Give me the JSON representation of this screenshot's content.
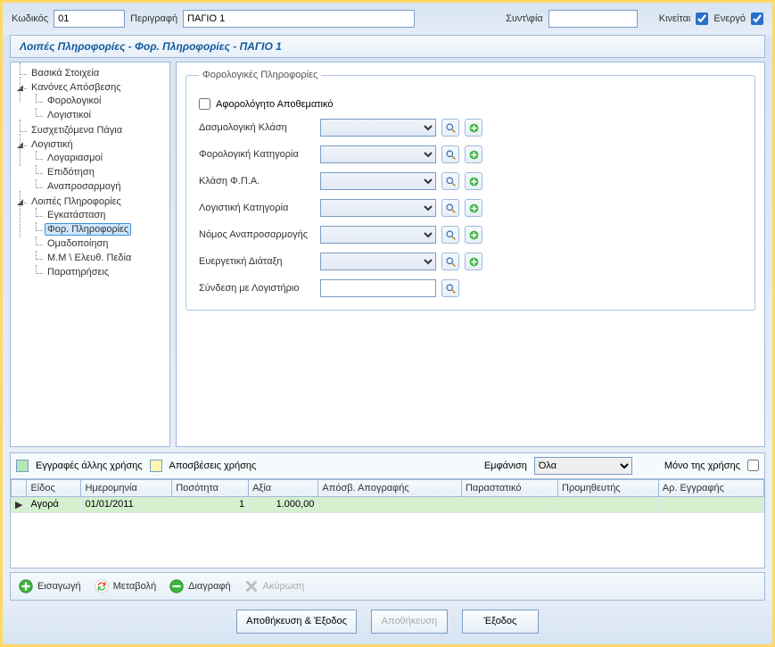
{
  "header": {
    "code_label": "Κωδικός",
    "code_value": "01",
    "desc_label": "Περιγραφή",
    "desc_value": "ΠΑΓΙΟ 1",
    "abbr_label": "Συντ\\φία",
    "abbr_value": "",
    "moves_label": "Κινείται",
    "moves_checked": true,
    "active_label": "Ενεργό",
    "active_checked": true
  },
  "breadcrumb_title": "Λοιπές Πληροφορίες - Φορ. Πληροφορίες - ΠΑΓΙΟ 1",
  "tree": {
    "n1": "Βασικά Στοιχεία",
    "n2": "Κανόνες Απόσβεσης",
    "n2a": "Φορολογικοί",
    "n2b": "Λογιστικοί",
    "n3": "Συσχετιζόμενα Πάγια",
    "n4": "Λογιστική",
    "n4a": "Λογαριασμοί",
    "n4b": "Επιδότηση",
    "n4c": "Αναπροσαρμογή",
    "n5": "Λοιπές Πληροφορίες",
    "n5a": "Εγκατάσταση",
    "n5b": "Φορ. Πληροφορίες",
    "n5c": "Ομαδοποίηση",
    "n5d": "Μ.Μ \\ Ελευθ. Πεδία",
    "n5e": "Παρατηρήσεις"
  },
  "form": {
    "legend": "Φορολογικές Πληροφορίες",
    "tax_free_reserve": "Αφορολόγητο Αποθεματικό",
    "tariff_class": "Δασμολογική Κλάση",
    "tax_category": "Φορολογική Κατηγορία",
    "vat_class": "Κλάση Φ.Π.Α.",
    "acct_category": "Λογιστική Κατηγορία",
    "readj_law": "Νόμος Αναπροσαρμογής",
    "benefit_order": "Ευεργετική Διάταξη",
    "link_ledger": "Σύνδεση με Λογιστήριο"
  },
  "bottom": {
    "legend_other_year": "Εγγραφές άλλης χρήσης",
    "legend_deprec": "Αποσβέσεις χρήσης",
    "show_label": "Εμφάνιση",
    "show_option": "Όλα",
    "only_year_label": "Μόνο της χρήσης",
    "columns": {
      "type": "Είδος",
      "date": "Ημερομηνία",
      "qty": "Ποσότητα",
      "value": "Αξία",
      "inv_depr": "Απόσβ. Απογραφής",
      "doc": "Παραστατικό",
      "supplier": "Προμηθευτής",
      "entry_no": "Αρ. Εγγραφής"
    },
    "rows": [
      {
        "type": "Αγορά",
        "date": "01/01/2011",
        "qty": "1",
        "value": "1.000,00",
        "inv_depr": "",
        "doc": "",
        "supplier": "",
        "entry_no": ""
      }
    ]
  },
  "actions": {
    "insert": "Εισαγωγή",
    "modify": "Μεταβολή",
    "delete": "Διαγραφή",
    "cancel": "Ακύρωση"
  },
  "dialog": {
    "save_exit": "Αποθήκευση & Έξοδος",
    "save": "Αποθήκευση",
    "exit": "Έξοδος"
  }
}
